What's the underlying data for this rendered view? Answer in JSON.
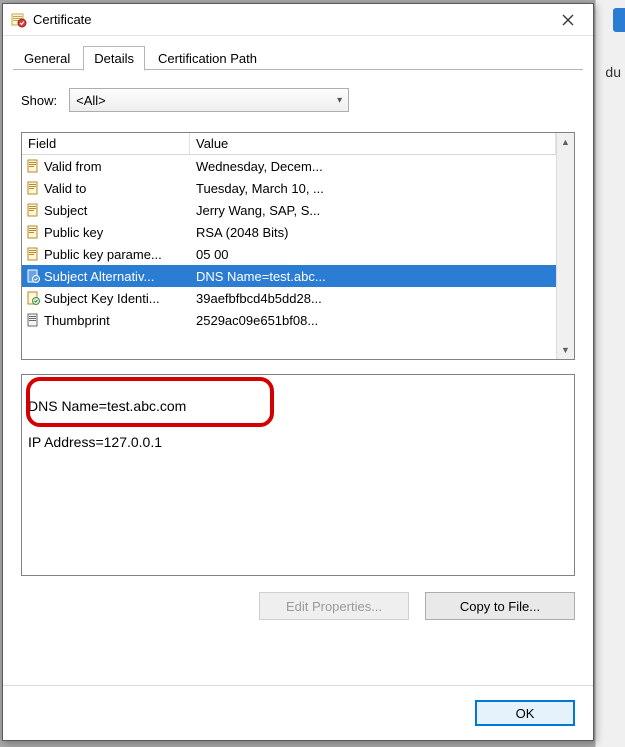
{
  "window": {
    "title": "Certificate"
  },
  "tabs": {
    "general": "General",
    "details": "Details",
    "certpath": "Certification Path"
  },
  "show": {
    "label": "Show:",
    "value": "<All>"
  },
  "columns": {
    "field": "Field",
    "value": "Value"
  },
  "rows": [
    {
      "field": "Valid from",
      "value": "Wednesday, Decem...",
      "icon": "doc",
      "selected": false
    },
    {
      "field": "Valid to",
      "value": "Tuesday, March 10, ...",
      "icon": "doc",
      "selected": false
    },
    {
      "field": "Subject",
      "value": "Jerry Wang, SAP, S...",
      "icon": "doc",
      "selected": false
    },
    {
      "field": "Public key",
      "value": "RSA (2048 Bits)",
      "icon": "doc",
      "selected": false
    },
    {
      "field": "Public key parame...",
      "value": "05 00",
      "icon": "doc",
      "selected": false
    },
    {
      "field": "Subject Alternativ...",
      "value": "DNS Name=test.abc...",
      "icon": "ext",
      "selected": true
    },
    {
      "field": "Subject Key Identi...",
      "value": "39aefbfbcd4b5dd28...",
      "icon": "ext",
      "selected": false
    },
    {
      "field": "Thumbprint",
      "value": "2529ac09e651bf08...",
      "icon": "prop",
      "selected": false
    }
  ],
  "detail": {
    "line1": "DNS Name=test.abc.com",
    "line2": "IP Address=127.0.0.1"
  },
  "buttons": {
    "edit": "Edit Properties...",
    "copy": "Copy to File...",
    "ok": "OK"
  },
  "bg_text": "du"
}
